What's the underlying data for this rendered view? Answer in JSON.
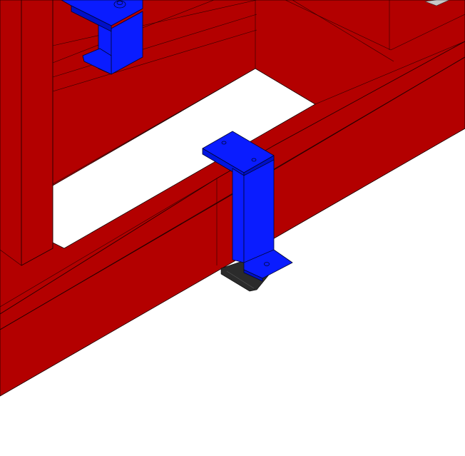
{
  "view": {
    "background": "#ffffff",
    "frame_color": "#b30000",
    "bracket_color": "#0a1cff",
    "pad_color": "#2b2b2b"
  },
  "labels": {}
}
